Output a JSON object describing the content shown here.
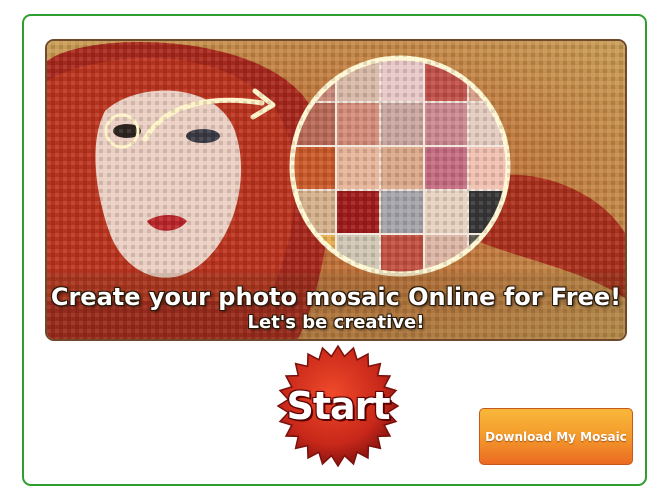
{
  "banner": {
    "headline": "Create your photo mosaic Online for Free!",
    "subheadline": "Let's be creative!"
  },
  "start_button": {
    "label": "Start"
  },
  "download_button": {
    "label": "Download My Mosaic"
  },
  "colors": {
    "frame_border": "#2f9e2f",
    "start_red": "#c8281a",
    "download_orange": "#f39a2c"
  }
}
